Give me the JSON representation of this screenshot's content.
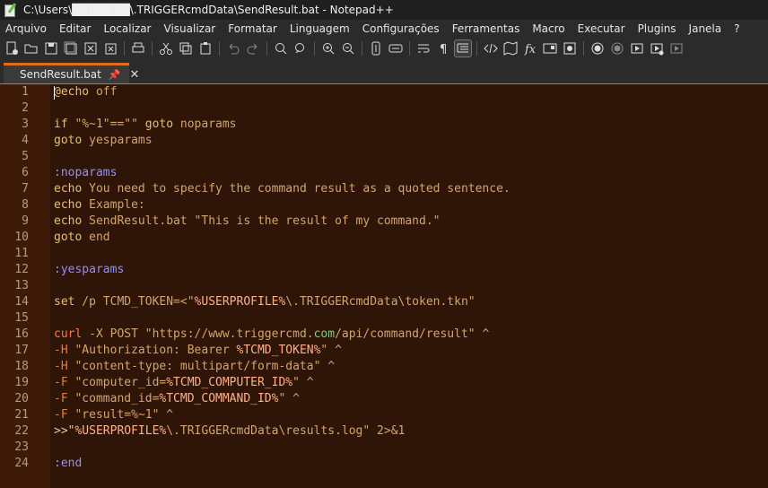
{
  "window": {
    "title": "C:\\Users\\███████\\.TRIGGERcmdData\\SendResult.bat - Notepad++"
  },
  "menu": [
    "Arquivo",
    "Editar",
    "Localizar",
    "Visualizar",
    "Formatar",
    "Linguagem",
    "Configurações",
    "Ferramentas",
    "Macro",
    "Executar",
    "Plugins",
    "Janela",
    "?"
  ],
  "toolbar": {
    "icons": [
      "new-file-icon",
      "open-file-icon",
      "save-icon",
      "save-all-icon",
      "close-icon",
      "close-all-icon",
      "print-icon",
      "cut-icon",
      "copy-icon",
      "paste-icon",
      "undo-icon",
      "redo-icon",
      "find-icon",
      "replace-icon",
      "zoom-in-icon",
      "zoom-out-icon",
      "sync-vertical-icon",
      "sync-horizontal-icon",
      "word-wrap-icon",
      "show-all-chars-icon",
      "indent-guide-icon",
      "language-icon",
      "document-map-icon",
      "function-list-icon",
      "folder-workspace-icon",
      "monitoring-icon",
      "record-macro-icon",
      "stop-macro-icon",
      "play-macro-icon",
      "run-macro-multiple-icon",
      "save-macro-icon"
    ]
  },
  "tab": {
    "label": "SendResult.bat",
    "pin": "📌",
    "close": "✕"
  },
  "editor": {
    "lines": [
      {
        "n": "1",
        "segs": [
          {
            "c": "k-cmd",
            "t": "@echo"
          },
          {
            "c": "k-text",
            "t": " off"
          }
        ]
      },
      {
        "n": "2",
        "segs": []
      },
      {
        "n": "3",
        "segs": [
          {
            "c": "k-cmd",
            "t": "if"
          },
          {
            "c": "k-text",
            "t": " \"%~1\"==\"\" "
          },
          {
            "c": "k-cmd",
            "t": "goto"
          },
          {
            "c": "k-text",
            "t": " noparams"
          }
        ]
      },
      {
        "n": "4",
        "segs": [
          {
            "c": "k-cmd",
            "t": "goto"
          },
          {
            "c": "k-text",
            "t": " yesparams"
          }
        ]
      },
      {
        "n": "5",
        "segs": []
      },
      {
        "n": "6",
        "segs": [
          {
            "c": "k-label",
            "t": ":noparams"
          }
        ]
      },
      {
        "n": "7",
        "segs": [
          {
            "c": "k-cmd",
            "t": "echo"
          },
          {
            "c": "k-text",
            "t": " You need to specify the command result as a quoted sentence."
          }
        ]
      },
      {
        "n": "8",
        "segs": [
          {
            "c": "k-cmd",
            "t": "echo"
          },
          {
            "c": "k-text",
            "t": " Example:"
          }
        ]
      },
      {
        "n": "9",
        "segs": [
          {
            "c": "k-cmd",
            "t": "echo"
          },
          {
            "c": "k-text",
            "t": " SendResult.bat \"This is the result of my command.\""
          }
        ]
      },
      {
        "n": "10",
        "segs": [
          {
            "c": "k-cmd",
            "t": "goto"
          },
          {
            "c": "k-text",
            "t": " end"
          }
        ]
      },
      {
        "n": "11",
        "segs": []
      },
      {
        "n": "12",
        "segs": [
          {
            "c": "k-label",
            "t": ":yesparams"
          }
        ]
      },
      {
        "n": "13",
        "segs": []
      },
      {
        "n": "14",
        "segs": [
          {
            "c": "k-cmd",
            "t": "set"
          },
          {
            "c": "k-text",
            "t": " /p TCMD_TOKEN=<\""
          },
          {
            "c": "k-var",
            "t": "%USERPROFILE%"
          },
          {
            "c": "k-text",
            "t": "\\.TRIGGERcmdData\\token.tkn\""
          }
        ]
      },
      {
        "n": "15",
        "segs": []
      },
      {
        "n": "16",
        "segs": [
          {
            "c": "k-curl",
            "t": "curl"
          },
          {
            "c": "k-text",
            "t": " -X POST \"https://www.triggercmd."
          },
          {
            "c": "k-url",
            "t": "com"
          },
          {
            "c": "k-text",
            "t": "/api/command/result\" ^"
          }
        ]
      },
      {
        "n": "17",
        "segs": [
          {
            "c": "k-flag",
            "t": "-H"
          },
          {
            "c": "k-text",
            "t": " \"Authorization: Bearer "
          },
          {
            "c": "k-var",
            "t": "%TCMD_TOKEN%"
          },
          {
            "c": "k-text",
            "t": "\" ^"
          }
        ]
      },
      {
        "n": "18",
        "segs": [
          {
            "c": "k-flag",
            "t": "-H"
          },
          {
            "c": "k-text",
            "t": " \"content-type: multipart/form-data\" ^"
          }
        ]
      },
      {
        "n": "19",
        "segs": [
          {
            "c": "k-flag",
            "t": "-F"
          },
          {
            "c": "k-text",
            "t": " \"computer_id="
          },
          {
            "c": "k-var",
            "t": "%TCMD_COMPUTER_ID%"
          },
          {
            "c": "k-text",
            "t": "\" ^"
          }
        ]
      },
      {
        "n": "20",
        "segs": [
          {
            "c": "k-flag",
            "t": "-F"
          },
          {
            "c": "k-text",
            "t": " \"command_id="
          },
          {
            "c": "k-var",
            "t": "%TCMD_COMMAND_ID%"
          },
          {
            "c": "k-text",
            "t": "\" ^"
          }
        ]
      },
      {
        "n": "21",
        "segs": [
          {
            "c": "k-flag",
            "t": "-F"
          },
          {
            "c": "k-text",
            "t": " \"result=%~1\" ^"
          }
        ]
      },
      {
        "n": "22",
        "segs": [
          {
            "c": "k-str",
            "t": ">>\""
          },
          {
            "c": "k-var",
            "t": "%USERPROFILE%"
          },
          {
            "c": "k-text",
            "t": "\\.TRIGGERcmdData\\results.log\" 2>&1"
          }
        ]
      },
      {
        "n": "23",
        "segs": []
      },
      {
        "n": "24",
        "segs": [
          {
            "c": "k-label",
            "t": ":end"
          }
        ]
      }
    ]
  },
  "colors": {
    "accent": "#e06c1a",
    "editor_bg": "#2e1508",
    "gutter_bg": "#3e1b09"
  }
}
